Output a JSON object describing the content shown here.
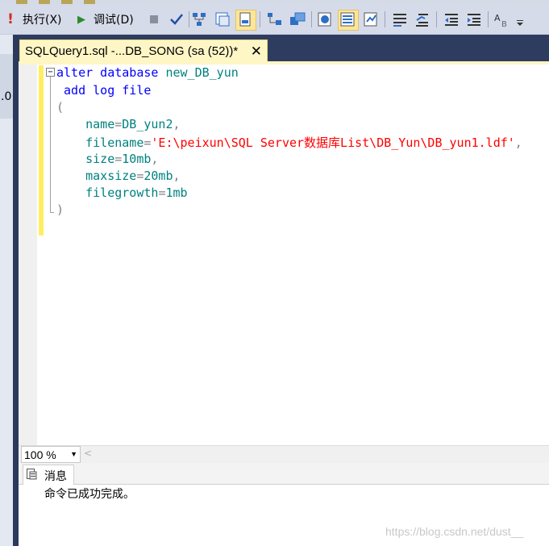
{
  "toolbar": {
    "execute_label": "执行(X)",
    "debug_label": "调试(D)",
    "icons": [
      "execute-icon",
      "debug-icon",
      "stop-icon",
      "parse-icon",
      "display-plan-icon",
      "query-designer-icon",
      "results-file-icon",
      "results-text-icon",
      "results-grid-icon",
      "client-stats-icon",
      "actual-plan-icon",
      "include-stats-icon",
      "comment-icon",
      "uncomment-icon",
      "decrease-indent-icon",
      "increase-indent-icon",
      "specify-values-icon"
    ]
  },
  "side": {
    "partial_text": ".0"
  },
  "tab": {
    "title": "SQLQuery1.sql -...DB_SONG (sa (52))*",
    "close": "✕"
  },
  "editor": {
    "collapse_symbol": "−",
    "lines": [
      {
        "segments": [
          [
            "kw",
            "alter database "
          ],
          [
            "tx",
            "new_DB_yun"
          ]
        ]
      },
      {
        "segments": [
          [
            "kw",
            " add log file"
          ]
        ]
      },
      {
        "segments": [
          [
            "gr",
            "("
          ]
        ]
      },
      {
        "segments": [
          [
            "tx",
            "    name"
          ],
          [
            "gr",
            "="
          ],
          [
            "tx",
            "DB_yun2"
          ],
          [
            "gr",
            ","
          ]
        ]
      },
      {
        "segments": [
          [
            "tx",
            "    filename"
          ],
          [
            "gr",
            "="
          ],
          [
            "st",
            "'E:\\peixun\\SQL Server数据库List\\DB_Yun\\DB_yun1.ldf'"
          ],
          [
            "gr",
            ","
          ]
        ]
      },
      {
        "segments": [
          [
            "tx",
            "    size"
          ],
          [
            "gr",
            "="
          ],
          [
            "tx",
            "10mb"
          ],
          [
            "gr",
            ","
          ]
        ]
      },
      {
        "segments": [
          [
            "tx",
            "    maxsize"
          ],
          [
            "gr",
            "="
          ],
          [
            "tx",
            "20mb"
          ],
          [
            "gr",
            ","
          ]
        ]
      },
      {
        "segments": [
          [
            "tx",
            "    filegrowth"
          ],
          [
            "gr",
            "="
          ],
          [
            "tx",
            "1mb"
          ]
        ]
      },
      {
        "segments": [
          [
            "gr",
            ")"
          ]
        ]
      }
    ]
  },
  "zoom": {
    "value": "100 %",
    "arrow": "▼"
  },
  "scroll_arrow": "<",
  "results": {
    "tab_label": "消息",
    "message": "命令已成功完成。"
  },
  "watermark": "https://blog.csdn.net/dust__"
}
